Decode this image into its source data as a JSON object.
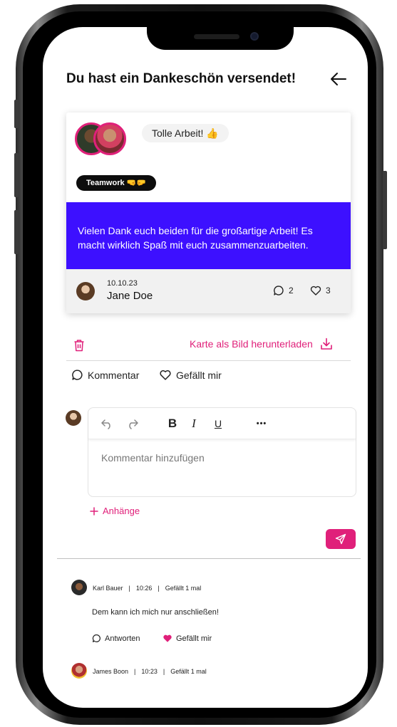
{
  "header": {
    "title": "Du hast ein Dankeschön versendet!",
    "back_icon": "arrow-left-icon"
  },
  "card": {
    "tag": "Tolle Arbeit! 👍",
    "value_badge": "Teamwork 🤜🤛",
    "message": "Vielen Dank euch beiden für die großartige Arbeit! Es macht wirklich Spaß mit euch zusammenzuarbeiten.",
    "date": "10.10.23",
    "author": "Jane Doe",
    "comment_count": "2",
    "like_count": "3"
  },
  "actions": {
    "download_label": "Karte als Bild herunterladen",
    "comment_label": "Kommentar",
    "like_label": "Gefällt mir"
  },
  "editor": {
    "placeholder": "Kommentar hinzufügen",
    "bold": "B",
    "italic": "I",
    "underline": "U",
    "more": "•••",
    "attachments_label": "Anhänge"
  },
  "comments": [
    {
      "name": "Karl Bauer",
      "time": "10:26",
      "likes": "Gefällt 1 mal",
      "text": "Dem kann ich mich nur anschließen!",
      "reply_label": "Antworten",
      "like_label": "Gefällt mir"
    },
    {
      "name": "James Boon",
      "time": "10:23",
      "likes": "Gefällt 1 mal"
    }
  ],
  "colors": {
    "accent": "#e0207a",
    "message_bg": "#3d10ff",
    "pill_bg": "#0d0d0d"
  }
}
